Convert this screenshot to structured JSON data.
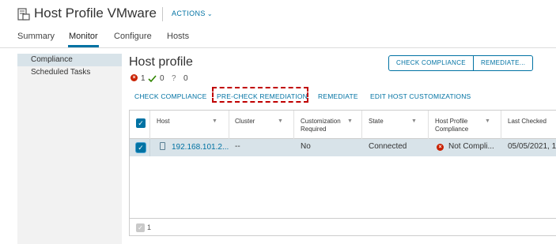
{
  "header": {
    "title": "Host Profile VMware",
    "actions_label": "ACTIONS",
    "host_icon": "host-profile-icon"
  },
  "tabs": [
    {
      "label": "Summary"
    },
    {
      "label": "Monitor",
      "active": true
    },
    {
      "label": "Configure"
    },
    {
      "label": "Hosts"
    }
  ],
  "sidebar": {
    "items": [
      {
        "label": "Compliance",
        "active": true
      },
      {
        "label": "Scheduled Tasks"
      }
    ]
  },
  "main": {
    "title": "Host profile",
    "status": {
      "noncompliant_count": "1",
      "compliant_count": "0",
      "unknown_count": "0"
    },
    "top_buttons": [
      "CHECK COMPLIANCE",
      "REMEDIATE..."
    ],
    "links": [
      "CHECK COMPLIANCE",
      "PRE-CHECK REMEDIATION",
      "REMEDIATE",
      "EDIT HOST CUSTOMIZATIONS"
    ],
    "highlighted_link": "PRE-CHECK REMEDIATION"
  },
  "grid": {
    "columns": [
      {
        "label": "Host"
      },
      {
        "label": "Cluster"
      },
      {
        "label": "Customization Required"
      },
      {
        "label": "State"
      },
      {
        "label": "Host Profile Compliance"
      },
      {
        "label": "Last Checked"
      }
    ],
    "rows": [
      {
        "selected": true,
        "host": "192.168.101.2...",
        "cluster": "--",
        "customization_required": "No",
        "state": "Connected",
        "compliance": "Not Compli...",
        "last_checked": "05/05/2021, 1"
      }
    ],
    "footer_count": "1"
  },
  "colors": {
    "link_blue": "#0072a3",
    "selected_row": "#d8e3e9",
    "error_red": "#c92100",
    "highlight_dash": "#c00000",
    "ok_green": "#2f8400"
  }
}
